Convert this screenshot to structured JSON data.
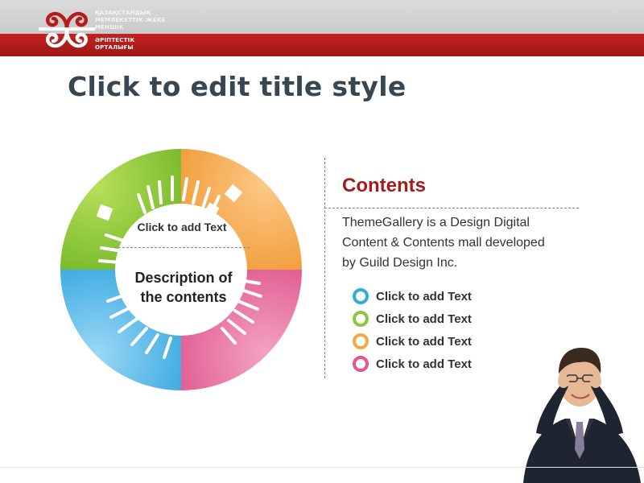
{
  "header": {
    "org_line1": "ҚАЗАҚСТАНДЫҚ\nМЕМЛЕКЕТТІК-ЖЕКЕ\nМЕНШІК",
    "org_line2": "ӘРІПТЕСТІК\nОРТАЛЫҒЫ"
  },
  "slide": {
    "title": "Click to edit title style"
  },
  "ring": {
    "label": "Click to add Text",
    "description": "Description of\nthe contents",
    "segment_colors": [
      "#8cc63f",
      "#f4a947",
      "#e7689b",
      "#4cb4e7"
    ]
  },
  "contents": {
    "title": "Contents",
    "body": "ThemeGallery  is a Design Digital\nContent & Contents mall developed\nby Guild Design Inc.",
    "items": [
      {
        "label": "Click to add Text",
        "color": "#3aa9e0"
      },
      {
        "label": "Click to add Text",
        "color": "#8cc63f"
      },
      {
        "label": "Click to add Text",
        "color": "#f4a947"
      },
      {
        "label": "Click to add Text",
        "color": "#e0578f"
      }
    ]
  }
}
